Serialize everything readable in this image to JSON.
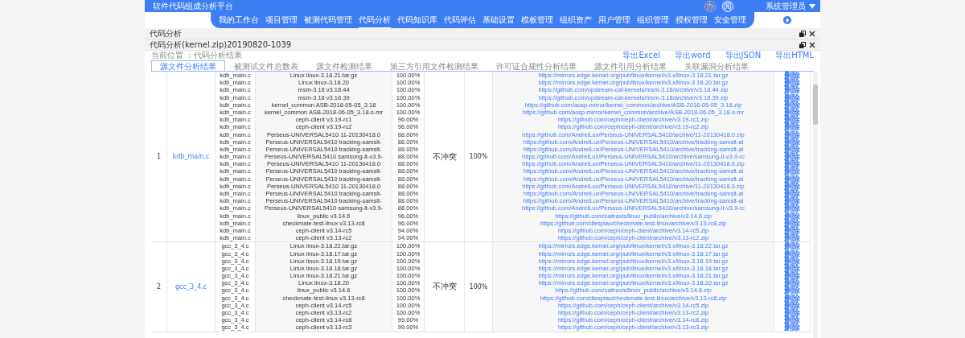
{
  "header": {
    "title": "软件代码组成分析平台",
    "badges": [
      "办",
      "阅"
    ],
    "user": "系统管理员"
  },
  "nav": [
    {
      "label": "我的工作台",
      "selected": false
    },
    {
      "label": "项目管理",
      "selected": false
    },
    {
      "label": "被测代码管理",
      "selected": false
    },
    {
      "label": "代码分析",
      "selected": true
    },
    {
      "label": "代码知识库",
      "selected": false
    },
    {
      "label": "代码评估",
      "selected": false
    },
    {
      "label": "基础设置",
      "selected": false
    },
    {
      "label": "模板管理",
      "selected": false
    },
    {
      "label": "组织资产",
      "selected": false
    },
    {
      "label": "用户管理",
      "selected": false
    },
    {
      "label": "组织管理",
      "selected": false
    },
    {
      "label": "授权管理",
      "selected": false
    },
    {
      "label": "安全管理",
      "selected": false
    }
  ],
  "panels": [
    {
      "title": "代码分析"
    },
    {
      "title": "代码分析(kernel.zip)20190820-1039"
    }
  ],
  "breadcrumb": "当前位置 ：代码分析结果",
  "exports": [
    "导出Excel",
    "导出word",
    "导出JSON",
    "导出HTML"
  ],
  "tabs": [
    {
      "label": "源文件分析结果",
      "selected": true
    },
    {
      "label": "被测试文件总数表",
      "selected": false
    },
    {
      "label": "源文件检测结果",
      "selected": false
    },
    {
      "label": "第三方引用文件检测结果",
      "selected": false
    },
    {
      "label": "许可证合规性分析结果",
      "selected": false
    },
    {
      "label": "源文件引用分析结果",
      "selected": false
    },
    {
      "label": "关联漏洞分析结果",
      "selected": false
    }
  ],
  "table": {
    "rows": [
      {
        "index": "1",
        "file": "kdb_main.c",
        "column_6": "不冲突",
        "column_7": "100%",
        "lines": [
          {
            "column_3": "kdb_main.c",
            "column_4": "Linux linux-3.18.21.tar.gz",
            "column_5": "100.00%",
            "column_8": "https://mirrors.edge.kernel.org/pub/linux/kernel/v3.x/linux-3.18.21.tar.gz",
            "column_9": "删除"
          },
          {
            "column_3": "kdb_main.c",
            "column_4": "Linux linux-3.18.20",
            "column_5": "100.00%",
            "column_8": "https://mirrors.edge.kernel.org/pub/linux/kernel/v3.x/linux-3.18.20.tar.gz",
            "column_9": "删除"
          },
          {
            "column_3": "kdb_main.c",
            "column_4": "msm-3.18 v3.18.44",
            "column_5": "100.00%",
            "column_8": "https://github.com/upstream-caf-kernels/msm-3.18/archive/v3.18.44.zip",
            "column_9": "删除"
          },
          {
            "column_3": "kdb_main.c",
            "column_4": "msm-3.18 v3.18.39",
            "column_5": "100.00%",
            "column_8": "https://github.com/upstream-caf-kernels/msm-3.18/archive/v3.18.39.zip",
            "column_9": "删除"
          },
          {
            "column_3": "kdb_main.c",
            "column_4": "kernel_common ASB-2018-05-05_3.18",
            "column_5": "100.00%",
            "column_8": "https://github.com/aosp-mirror/kernel_common/archive/ASB-2018-05-05_3.18.zip",
            "column_9": "删除"
          },
          {
            "column_3": "kdb_main.c",
            "column_4": "kernel_common ASB-2018-06-05_3.18-s-mr",
            "column_5": "100.00%",
            "column_8": "https://github.com/aosp-mirror/kernel_common/archive/ASB-2018-06-05_3.18-s-mr",
            "column_9": "删除"
          },
          {
            "column_3": "kdb_main.c",
            "column_4": "ceph-client v3.19-rc1",
            "column_5": "96.00%",
            "column_8": "https://github.com/ceph/ceph-client/archive/v3.19-rc1.zip",
            "column_9": "删除"
          },
          {
            "column_3": "kdb_main.c",
            "column_4": "ceph-client v3.19-rc2",
            "column_5": "96.00%",
            "column_8": "https://github.com/ceph/ceph-client/archive/v3.19-rc2.zip",
            "column_9": "删除"
          },
          {
            "column_3": "kdb_main.c",
            "column_4": "Perseus-UNIVERSAL5410 11-20130418.0",
            "column_5": "88.00%",
            "column_8": "https://github.com/AndreiLux/Perseus-UNIVERSAL5410/archive/11-20130418.0.zip",
            "column_9": "删除"
          },
          {
            "column_3": "kdb_main.c",
            "column_4": "Perseus-UNIVERSAL5410 tracking-samslt-",
            "column_5": "88.00%",
            "column_8": "https://github.com/AndreiLux/Perseus-UNIVERSAL5410/archive/tracking-samslt-al",
            "column_9": "删除"
          },
          {
            "column_3": "kdb_main.c",
            "column_4": "Perseus-UNIVERSAL5410 tracking-samslt-",
            "column_5": "88.00%",
            "column_8": "https://github.com/AndreiLux/Perseus-UNIVERSAL5410/archive/tracking-samslt-al",
            "column_9": "删除"
          },
          {
            "column_3": "kdb_main.c",
            "column_4": "Perseus-UNIVERSAL5410 samsung-lt-v3.9-",
            "column_5": "88.00%",
            "column_8": "https://github.com/AndreiLux/Perseus-UNIVERSAL5410/archive/samsung-lt-v3.9-rc",
            "column_9": "删除"
          },
          {
            "column_3": "kdb_main.c",
            "column_4": "Perseus-UNIVERSAL5410 11-20130418.0",
            "column_5": "88.00%",
            "column_8": "https://github.com/AndreiLux/Perseus-UNIVERSAL5410/archive/11-20130418.0.zip",
            "column_9": "删除"
          },
          {
            "column_3": "kdb_main.c",
            "column_4": "Perseus-UNIVERSAL5410 tracking-samslt-",
            "column_5": "88.00%",
            "column_8": "https://github.com/AndreiLux/Perseus-UNIVERSAL5410/archive/tracking-samslt-al",
            "column_9": "删除"
          },
          {
            "column_3": "kdb_main.c",
            "column_4": "Perseus-UNIVERSAL5410 tracking-samslt-",
            "column_5": "88.00%",
            "column_8": "https://github.com/AndreiLux/Perseus-UNIVERSAL5410/archive/tracking-samslt-al",
            "column_9": "删除"
          },
          {
            "column_3": "kdb_main.c",
            "column_4": "Perseus-UNIVERSAL5410 11-20130418.0",
            "column_5": "88.00%",
            "column_8": "https://github.com/AndreiLux/Perseus-UNIVERSAL5410/archive/11-20130418.0.zip",
            "column_9": "删除"
          },
          {
            "column_3": "kdb_main.c",
            "column_4": "Perseus-UNIVERSAL5410 tracking-samslt-",
            "column_5": "88.00%",
            "column_8": "https://github.com/AndreiLux/Perseus-UNIVERSAL5410/archive/tracking-samslt-al",
            "column_9": "删除"
          },
          {
            "column_3": "kdb_main.c",
            "column_4": "Perseus-UNIVERSAL5410 tracking-samslt-",
            "column_5": "88.00%",
            "column_8": "https://github.com/AndreiLux/Perseus-UNIVERSAL5410/archive/tracking-samslt-al",
            "column_9": "删除"
          },
          {
            "column_3": "kdb_main.c",
            "column_4": "Perseus-UNIVERSAL5410 samsung-lt-v3.9-",
            "column_5": "88.00%",
            "column_8": "https://github.com/AndreiLux/Perseus-UNIVERSAL5410/archive/samsung-lt-v3.9-rc",
            "column_9": "删除"
          },
          {
            "column_3": "kdb_main.c",
            "column_4": "linux_public v3.14.6",
            "column_5": "96.00%",
            "column_8": "https://github.com/zaitravis/linux_public/archive/v3.14.6.zip",
            "column_9": "删除"
          },
          {
            "column_3": "kdb_main.c",
            "column_4": "checkmate-test-linux v3.13-rc8",
            "column_5": "96.00%",
            "column_8": "https://github.com/dlespiau/checkmate-test-linux/archive/v3.13-rc8.zip",
            "column_9": "删除"
          },
          {
            "column_3": "kdb_main.c",
            "column_4": "ceph-client v3.14-rc5",
            "column_5": "94.00%",
            "column_8": "https://github.com/ceph/ceph-client/archive/v3.14-rc5.zip",
            "column_9": "删除"
          },
          {
            "column_3": "kdb_main.c",
            "column_4": "ceph-client v3.13-rc2",
            "column_5": "94.00%",
            "column_8": "https://github.com/ceph/ceph-client/archive/v3.13-rc2.zip",
            "column_9": "删除"
          }
        ]
      },
      {
        "index": "2",
        "file": "gcc_3_4.c",
        "column_6": "不冲突",
        "column_7": "100%",
        "lines": [
          {
            "column_3": "gcc_3_4.c",
            "column_4": "Linux linux-3.18.22.tar.gz",
            "column_5": "100.00%",
            "column_8": "https://mirrors.edge.kernel.org/pub/linux/kernel/v3.x/linux-3.18.22.tar.gz",
            "column_9": "删除"
          },
          {
            "column_3": "gcc_3_4.c",
            "column_4": "Linux linux-3.18.17.tar.gz",
            "column_5": "100.00%",
            "column_8": "https://mirrors.edge.kernel.org/pub/linux/kernel/v3.x/linux-3.18.17.tar.gz",
            "column_9": "删除"
          },
          {
            "column_3": "gcc_3_4.c",
            "column_4": "Linux linux-3.18.19.tar.gz",
            "column_5": "100.00%",
            "column_8": "https://mirrors.edge.kernel.org/pub/linux/kernel/v3.x/linux-3.18.19.tar.gz",
            "column_9": "删除"
          },
          {
            "column_3": "gcc_3_4.c",
            "column_4": "Linux linux-3.18.18.tar.gz",
            "column_5": "100.00%",
            "column_8": "https://mirrors.edge.kernel.org/pub/linux/kernel/v3.x/linux-3.18.18.tar.gz",
            "column_9": "删除"
          },
          {
            "column_3": "gcc_3_4.c",
            "column_4": "Linux linux-3.18.21.tar.gz",
            "column_5": "100.00%",
            "column_8": "https://mirrors.edge.kernel.org/pub/linux/kernel/v3.x/linux-3.18.21.tar.gz",
            "column_9": "删除"
          },
          {
            "column_3": "gcc_3_4.c",
            "column_4": "Linux linux-3.18.20",
            "column_5": "100.00%",
            "column_8": "https://mirrors.edge.kernel.org/pub/linux/kernel/v3.x/linux-3.18.20.tar.gz",
            "column_9": "删除"
          },
          {
            "column_3": "gcc_3_4.c",
            "column_4": "linux_public v3.14.6",
            "column_5": "100.00%",
            "column_8": "https://github.com/zaitravis/linux_public/archive/v3.14.6.zip",
            "column_9": "删除"
          },
          {
            "column_3": "gcc_3_4.c",
            "column_4": "checkmate-test-linux v3.13-rc8",
            "column_5": "100.00%",
            "column_8": "https://github.com/dlespiau/checkmate-test-linux/archive/v3.13-rc8.zip",
            "column_9": "删除"
          },
          {
            "column_3": "gcc_3_4.c",
            "column_4": "ceph-client v3.14-rc5",
            "column_5": "100.00%",
            "column_8": "https://github.com/ceph/ceph-client/archive/v3.14-rc5.zip",
            "column_9": "删除"
          },
          {
            "column_3": "gcc_3_4.c",
            "column_4": "ceph-client v3.13-rc2",
            "column_5": "100.00%",
            "column_8": "https://github.com/ceph/ceph-client/archive/v3.13-rc2.zip",
            "column_9": "删除"
          },
          {
            "column_3": "gcc_3_4.c",
            "column_4": "ceph-client v3.14-rc8",
            "column_5": "99.00%",
            "column_8": "https://github.com/ceph/ceph-client/archive/v3.14-rc8.zip",
            "column_9": "删除"
          },
          {
            "column_3": "gcc_3_4.c",
            "column_4": "ceph-client v3.13-rc3",
            "column_5": "99.00%",
            "column_8": "https://github.com/ceph/ceph-client/archive/v3.13-rc3.zip",
            "column_9": "删除"
          }
        ]
      }
    ]
  }
}
